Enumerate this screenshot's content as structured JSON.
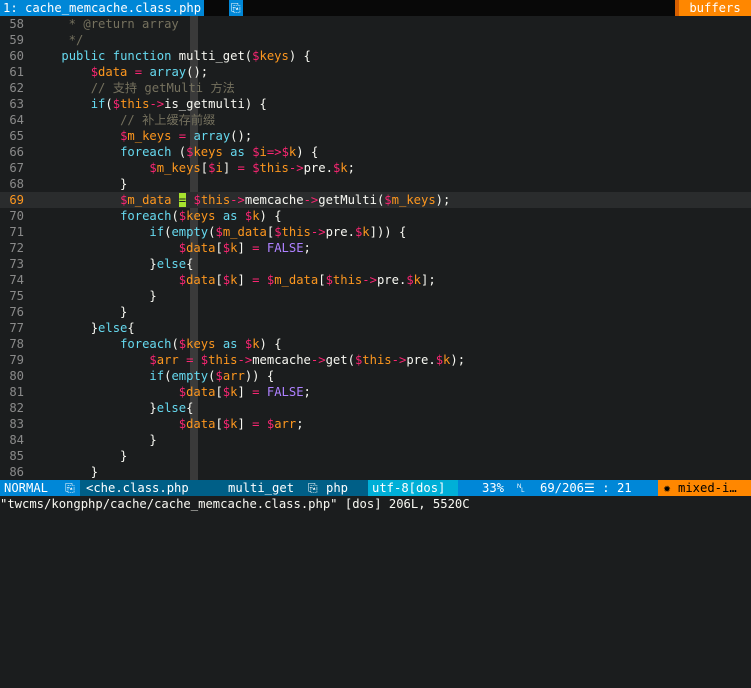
{
  "tabline": {
    "active_tab": "1: cache_memcache.class.php",
    "tab_icon": "⎘",
    "buffers_label": "buffers"
  },
  "editor": {
    "current_line": 69,
    "lines": [
      {
        "n": "58",
        "tokens": [
          [
            "cm",
            "     * @return array"
          ]
        ]
      },
      {
        "n": "59",
        "tokens": [
          [
            "cm",
            "     */"
          ]
        ]
      },
      {
        "n": "60",
        "tokens": [
          [
            "",
            "    "
          ],
          [
            "kw",
            "public"
          ],
          [
            "",
            " "
          ],
          [
            "kw",
            "function"
          ],
          [
            "",
            " multi_get("
          ],
          [
            "dol",
            "$"
          ],
          [
            "var",
            "keys"
          ],
          [
            "",
            ") {"
          ]
        ]
      },
      {
        "n": "61",
        "tokens": [
          [
            "",
            "        "
          ],
          [
            "dol",
            "$"
          ],
          [
            "var",
            "data"
          ],
          [
            "",
            " "
          ],
          [
            "op",
            "="
          ],
          [
            "",
            " "
          ],
          [
            "fn",
            "array"
          ],
          [
            "",
            "();"
          ]
        ]
      },
      {
        "n": "62",
        "tokens": [
          [
            "",
            "        "
          ],
          [
            "cm",
            "// 支持 getMulti 方法"
          ]
        ]
      },
      {
        "n": "63",
        "tokens": [
          [
            "",
            "        "
          ],
          [
            "kw",
            "if"
          ],
          [
            "",
            "("
          ],
          [
            "dol",
            "$"
          ],
          [
            "var",
            "this"
          ],
          [
            "op",
            "->"
          ],
          [
            "",
            "is_getmulti) {"
          ]
        ]
      },
      {
        "n": "64",
        "tokens": [
          [
            "",
            "            "
          ],
          [
            "cm",
            "// 补上缓存前缀"
          ]
        ]
      },
      {
        "n": "65",
        "tokens": [
          [
            "",
            "            "
          ],
          [
            "dol",
            "$"
          ],
          [
            "var",
            "m_keys"
          ],
          [
            "",
            " "
          ],
          [
            "op",
            "="
          ],
          [
            "",
            " "
          ],
          [
            "fn",
            "array"
          ],
          [
            "",
            "();"
          ]
        ]
      },
      {
        "n": "66",
        "tokens": [
          [
            "",
            "            "
          ],
          [
            "kw",
            "foreach"
          ],
          [
            "",
            " ("
          ],
          [
            "dol",
            "$"
          ],
          [
            "var",
            "keys"
          ],
          [
            "",
            " "
          ],
          [
            "kw",
            "as"
          ],
          [
            "",
            " "
          ],
          [
            "dol",
            "$"
          ],
          [
            "var",
            "i"
          ],
          [
            "op",
            "=>"
          ],
          [
            "dol",
            "$"
          ],
          [
            "var",
            "k"
          ],
          [
            "",
            ") {"
          ]
        ]
      },
      {
        "n": "67",
        "tokens": [
          [
            "",
            "                "
          ],
          [
            "dol",
            "$"
          ],
          [
            "var",
            "m_keys"
          ],
          [
            "",
            "["
          ],
          [
            "dol",
            "$"
          ],
          [
            "var",
            "i"
          ],
          [
            "",
            "] "
          ],
          [
            "op",
            "="
          ],
          [
            "",
            " "
          ],
          [
            "dol",
            "$"
          ],
          [
            "var",
            "this"
          ],
          [
            "op",
            "->"
          ],
          [
            "",
            "pre."
          ],
          [
            "dol",
            "$"
          ],
          [
            "var",
            "k"
          ],
          [
            "",
            ";"
          ]
        ]
      },
      {
        "n": "68",
        "tokens": [
          [
            "",
            "            }"
          ]
        ]
      },
      {
        "n": "69",
        "tokens": [
          [
            "",
            "            "
          ],
          [
            "dol",
            "$"
          ],
          [
            "var",
            "m_data"
          ],
          [
            "",
            " "
          ],
          [
            "cursor",
            "="
          ],
          [
            "",
            " "
          ],
          [
            "dol",
            "$"
          ],
          [
            "var",
            "this"
          ],
          [
            "op",
            "->"
          ],
          [
            "",
            "memcache"
          ],
          [
            "op",
            "->"
          ],
          [
            "",
            "getMulti("
          ],
          [
            "dol",
            "$"
          ],
          [
            "var",
            "m_keys"
          ],
          [
            "",
            ");"
          ]
        ]
      },
      {
        "n": "70",
        "tokens": [
          [
            "",
            "            "
          ],
          [
            "kw",
            "foreach"
          ],
          [
            "",
            "("
          ],
          [
            "dol",
            "$"
          ],
          [
            "var",
            "keys"
          ],
          [
            "",
            " "
          ],
          [
            "kw",
            "as"
          ],
          [
            "",
            " "
          ],
          [
            "dol",
            "$"
          ],
          [
            "var",
            "k"
          ],
          [
            "",
            ") {"
          ]
        ]
      },
      {
        "n": "71",
        "tokens": [
          [
            "",
            "                "
          ],
          [
            "kw",
            "if"
          ],
          [
            "",
            "("
          ],
          [
            "fn",
            "empty"
          ],
          [
            "",
            "("
          ],
          [
            "dol",
            "$"
          ],
          [
            "var",
            "m_data"
          ],
          [
            "",
            "["
          ],
          [
            "dol",
            "$"
          ],
          [
            "var",
            "this"
          ],
          [
            "op",
            "->"
          ],
          [
            "",
            "pre."
          ],
          [
            "dol",
            "$"
          ],
          [
            "var",
            "k"
          ],
          [
            "",
            "])) {"
          ]
        ]
      },
      {
        "n": "72",
        "tokens": [
          [
            "",
            "                    "
          ],
          [
            "dol",
            "$"
          ],
          [
            "var",
            "data"
          ],
          [
            "",
            "["
          ],
          [
            "dol",
            "$"
          ],
          [
            "var",
            "k"
          ],
          [
            "",
            "] "
          ],
          [
            "op",
            "="
          ],
          [
            "",
            " "
          ],
          [
            "const",
            "FALSE"
          ],
          [
            "",
            ";"
          ]
        ]
      },
      {
        "n": "73",
        "tokens": [
          [
            "",
            "                }"
          ],
          [
            "kw",
            "else"
          ],
          [
            "",
            "{"
          ]
        ]
      },
      {
        "n": "74",
        "tokens": [
          [
            "",
            "                    "
          ],
          [
            "dol",
            "$"
          ],
          [
            "var",
            "data"
          ],
          [
            "",
            "["
          ],
          [
            "dol",
            "$"
          ],
          [
            "var",
            "k"
          ],
          [
            "",
            "] "
          ],
          [
            "op",
            "="
          ],
          [
            "",
            " "
          ],
          [
            "dol",
            "$"
          ],
          [
            "var",
            "m_data"
          ],
          [
            "",
            "["
          ],
          [
            "dol",
            "$"
          ],
          [
            "var",
            "this"
          ],
          [
            "op",
            "->"
          ],
          [
            "",
            "pre."
          ],
          [
            "dol",
            "$"
          ],
          [
            "var",
            "k"
          ],
          [
            "",
            "];"
          ]
        ]
      },
      {
        "n": "75",
        "tokens": [
          [
            "",
            "                }"
          ]
        ]
      },
      {
        "n": "76",
        "tokens": [
          [
            "",
            "            }"
          ]
        ]
      },
      {
        "n": "77",
        "tokens": [
          [
            "",
            "        }"
          ],
          [
            "kw",
            "else"
          ],
          [
            "",
            "{"
          ]
        ]
      },
      {
        "n": "78",
        "tokens": [
          [
            "",
            "            "
          ],
          [
            "kw",
            "foreach"
          ],
          [
            "",
            "("
          ],
          [
            "dol",
            "$"
          ],
          [
            "var",
            "keys"
          ],
          [
            "",
            " "
          ],
          [
            "kw",
            "as"
          ],
          [
            "",
            " "
          ],
          [
            "dol",
            "$"
          ],
          [
            "var",
            "k"
          ],
          [
            "",
            ") {"
          ]
        ]
      },
      {
        "n": "79",
        "tokens": [
          [
            "",
            "                "
          ],
          [
            "dol",
            "$"
          ],
          [
            "var",
            "arr"
          ],
          [
            "",
            " "
          ],
          [
            "op",
            "="
          ],
          [
            "",
            " "
          ],
          [
            "dol",
            "$"
          ],
          [
            "var",
            "this"
          ],
          [
            "op",
            "->"
          ],
          [
            "",
            "memcache"
          ],
          [
            "op",
            "->"
          ],
          [
            "",
            "get("
          ],
          [
            "dol",
            "$"
          ],
          [
            "var",
            "this"
          ],
          [
            "op",
            "->"
          ],
          [
            "",
            "pre."
          ],
          [
            "dol",
            "$"
          ],
          [
            "var",
            "k"
          ],
          [
            "",
            ");"
          ]
        ]
      },
      {
        "n": "80",
        "tokens": [
          [
            "",
            "                "
          ],
          [
            "kw",
            "if"
          ],
          [
            "",
            "("
          ],
          [
            "fn",
            "empty"
          ],
          [
            "",
            "("
          ],
          [
            "dol",
            "$"
          ],
          [
            "var",
            "arr"
          ],
          [
            "",
            ")) {"
          ]
        ]
      },
      {
        "n": "81",
        "tokens": [
          [
            "",
            "                    "
          ],
          [
            "dol",
            "$"
          ],
          [
            "var",
            "data"
          ],
          [
            "",
            "["
          ],
          [
            "dol",
            "$"
          ],
          [
            "var",
            "k"
          ],
          [
            "",
            "] "
          ],
          [
            "op",
            "="
          ],
          [
            "",
            " "
          ],
          [
            "const",
            "FALSE"
          ],
          [
            "",
            ";"
          ]
        ]
      },
      {
        "n": "82",
        "tokens": [
          [
            "",
            "                }"
          ],
          [
            "kw",
            "else"
          ],
          [
            "",
            "{"
          ]
        ]
      },
      {
        "n": "83",
        "tokens": [
          [
            "",
            "                    "
          ],
          [
            "dol",
            "$"
          ],
          [
            "var",
            "data"
          ],
          [
            "",
            "["
          ],
          [
            "dol",
            "$"
          ],
          [
            "var",
            "k"
          ],
          [
            "",
            "] "
          ],
          [
            "op",
            "="
          ],
          [
            "",
            " "
          ],
          [
            "dol",
            "$"
          ],
          [
            "var",
            "arr"
          ],
          [
            "",
            ";"
          ]
        ]
      },
      {
        "n": "84",
        "tokens": [
          [
            "",
            "                }"
          ]
        ]
      },
      {
        "n": "85",
        "tokens": [
          [
            "",
            "            }"
          ]
        ]
      },
      {
        "n": "86",
        "tokens": [
          [
            "",
            "        }"
          ]
        ]
      }
    ]
  },
  "statusline": {
    "mode": "NORMAL",
    "file_icon": "⎘",
    "filename": "<che.class.php",
    "function": "multi_get",
    "lang_icon": "⎘",
    "filetype": "php",
    "encoding": "utf-8[dos]",
    "percent": "33%",
    "line_icon": "␤",
    "position": "69/206☰ : 21",
    "warning_icon": "✹",
    "warning": "mixed-i…"
  },
  "cmdline": {
    "text": "\"twcms/kongphp/cache/cache_memcache.class.php\" [dos] 206L, 5520C"
  },
  "colors": {
    "background": "#1b1d1e",
    "tab_blue": "#0087d7",
    "accent_orange": "#ff8700",
    "cursor_green": "#a6e22e",
    "mode_blue": "#0087d7",
    "encoding_cyan": "#00afd7"
  }
}
